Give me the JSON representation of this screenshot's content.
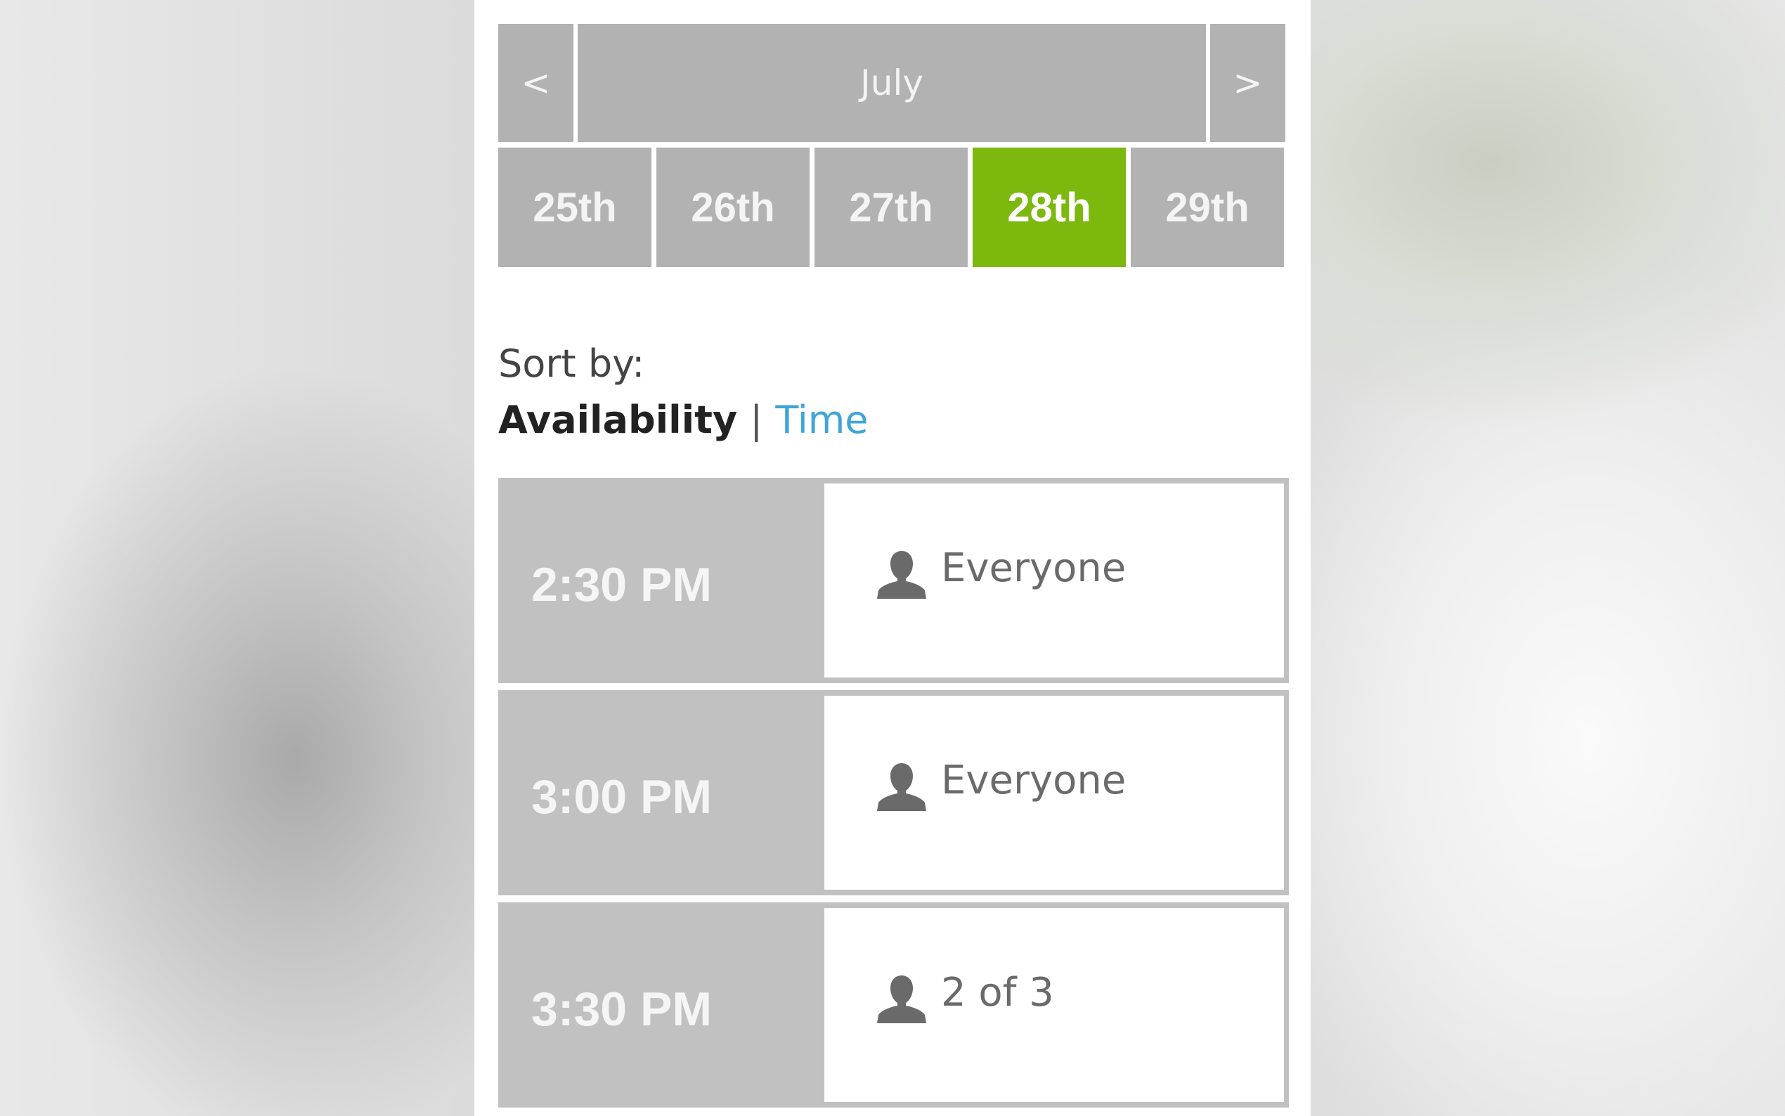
{
  "calendar": {
    "prev_label": "<",
    "month": "July",
    "next_label": ">",
    "days": [
      {
        "label": "25th",
        "selected": false
      },
      {
        "label": "26th",
        "selected": false
      },
      {
        "label": "27th",
        "selected": false
      },
      {
        "label": "28th",
        "selected": true
      },
      {
        "label": "29th",
        "selected": false
      }
    ]
  },
  "sort": {
    "label": "Sort by:",
    "availability": "Availability",
    "separator": "|",
    "time": "Time"
  },
  "slots": [
    {
      "time": "2:30 PM",
      "icon": "person-icon",
      "availability": "Everyone"
    },
    {
      "time": "3:00 PM",
      "icon": "person-icon",
      "availability": "Everyone"
    },
    {
      "time": "3:30 PM",
      "icon": "person-icon",
      "availability": "2 of 3"
    }
  ],
  "colors": {
    "tile_gray": "#b2b2b2",
    "slot_gray": "#c1c1c1",
    "selected_green": "#7db80f",
    "link_blue": "#3fa5d8",
    "icon_gray": "#6a6a6a"
  }
}
